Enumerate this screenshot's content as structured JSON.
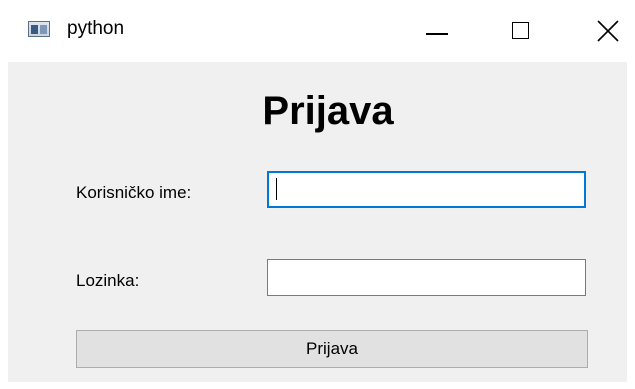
{
  "window": {
    "title": "python",
    "icon": "python-app-icon"
  },
  "controls": {
    "minimize": "minimize-icon",
    "maximize": "maximize-icon",
    "close": "close-icon"
  },
  "form": {
    "heading": "Prijava",
    "username_label": "Korisničko ime:",
    "username_value": "",
    "password_label": "Lozinka:",
    "password_value": "",
    "submit_label": "Prijava"
  },
  "colors": {
    "client_bg": "#f0f0f0",
    "focus_border": "#0078d7",
    "button_bg": "#e1e1e1"
  }
}
